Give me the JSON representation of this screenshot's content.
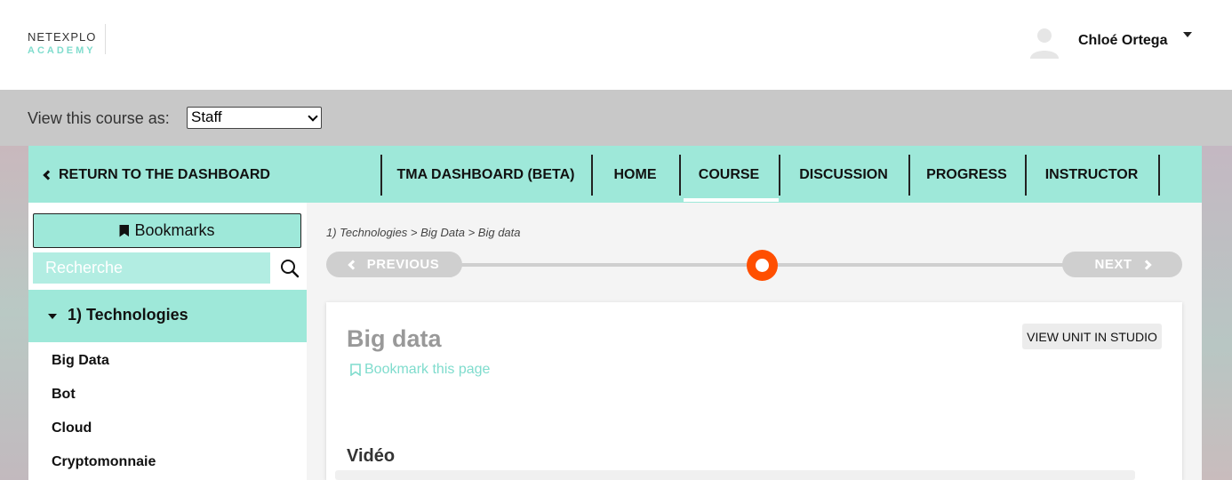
{
  "header": {
    "logo_top": "NETEXPLO",
    "logo_bottom": "ACADEMY",
    "user_name": "Chloé Ortega"
  },
  "view_as": {
    "label": "View this course as:",
    "selected": "Staff"
  },
  "nav": {
    "return_label": "RETURN TO THE DASHBOARD",
    "tabs": [
      {
        "label": "TMA DASHBOARD (BETA)"
      },
      {
        "label": "HOME"
      },
      {
        "label": "COURSE"
      },
      {
        "label": "DISCUSSION"
      },
      {
        "label": "PROGRESS"
      },
      {
        "label": "INSTRUCTOR"
      }
    ],
    "active_tab": "COURSE"
  },
  "sidebar": {
    "bookmarks_label": "Bookmarks",
    "search_placeholder": "Recherche",
    "chapter": "1) Technologies",
    "items": [
      {
        "label": "Big Data"
      },
      {
        "label": "Bot"
      },
      {
        "label": "Cloud"
      },
      {
        "label": "Cryptomonnaie"
      }
    ]
  },
  "main": {
    "breadcrumb": "1) Technologies > Big Data > Big data",
    "prev_label": "PREVIOUS",
    "next_label": "NEXT",
    "unit_title": "Big data",
    "bookmark_page_label": "Bookmark this page",
    "studio_button": "VIEW UNIT IN STUDIO",
    "video_heading": "Vidéo"
  },
  "colors": {
    "accent": "#9ee8d9",
    "marker": "#ff4f00",
    "bookmark_link": "#7fdccd"
  }
}
